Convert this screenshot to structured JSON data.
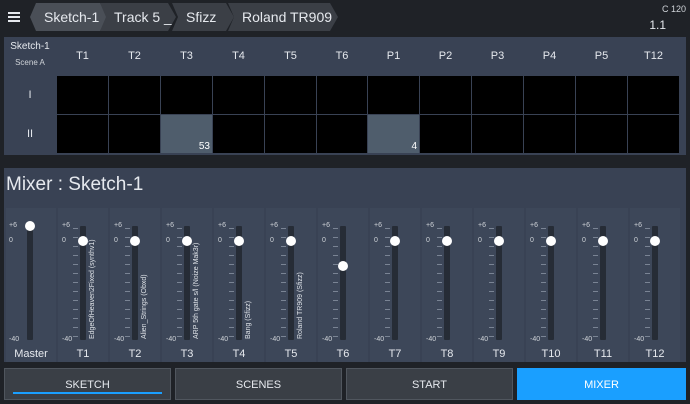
{
  "breadcrumbs": [
    "Sketch-1",
    "Track 5 _",
    "Sfizz",
    "Roland TR909"
  ],
  "tempo": "C 120",
  "bar": "1.1",
  "grid": {
    "title": "Sketch-1",
    "subtitle": "Scene A",
    "columns": [
      "T1",
      "T2",
      "T3",
      "T4",
      "T5",
      "T6",
      "P1",
      "P2",
      "P3",
      "P4",
      "P5",
      "T12"
    ],
    "rows": [
      "I",
      "II"
    ],
    "cells": [
      [
        null,
        null,
        null,
        null,
        null,
        null,
        null,
        null,
        null,
        null,
        null,
        null
      ],
      [
        null,
        null,
        "53",
        null,
        null,
        null,
        "4",
        null,
        null,
        null,
        null,
        null
      ]
    ]
  },
  "mixer": {
    "title": "Mixer : Sketch-1",
    "scale": {
      "top": "+6",
      "mid": "0",
      "bottom": "-40"
    },
    "strips": [
      {
        "name": "Master",
        "label": "",
        "level_db": 6
      },
      {
        "name": "T1",
        "label": "EdgeOfHeaven2Fixed (synthv1)",
        "level_db": 0
      },
      {
        "name": "T2",
        "label": "Alien_Strings (Obxd)",
        "level_db": 0
      },
      {
        "name": "T3",
        "label": "ARP 5th gate s/l (Noize Mak3r)",
        "level_db": 0
      },
      {
        "name": "T4",
        "label": "Bang (Sfizz)",
        "level_db": 0
      },
      {
        "name": "T5",
        "label": "Roland TR909 (Sfizz)",
        "level_db": 0
      },
      {
        "name": "T6",
        "label": "",
        "level_db": -10
      },
      {
        "name": "T7",
        "label": "",
        "level_db": 0
      },
      {
        "name": "T8",
        "label": "",
        "level_db": 0
      },
      {
        "name": "T9",
        "label": "",
        "level_db": 0
      },
      {
        "name": "T10",
        "label": "",
        "level_db": 0
      },
      {
        "name": "T11",
        "label": "",
        "level_db": 0
      },
      {
        "name": "T12",
        "label": "",
        "level_db": 0
      }
    ]
  },
  "tabs": [
    {
      "label": "SKETCH",
      "state": "selected"
    },
    {
      "label": "SCENES",
      "state": "normal"
    },
    {
      "label": "START",
      "state": "normal"
    },
    {
      "label": "MIXER",
      "state": "active"
    }
  ],
  "colors": {
    "accent": "#1a9fff",
    "panel": "#394254",
    "cell_filled": "#4f5d6c"
  }
}
